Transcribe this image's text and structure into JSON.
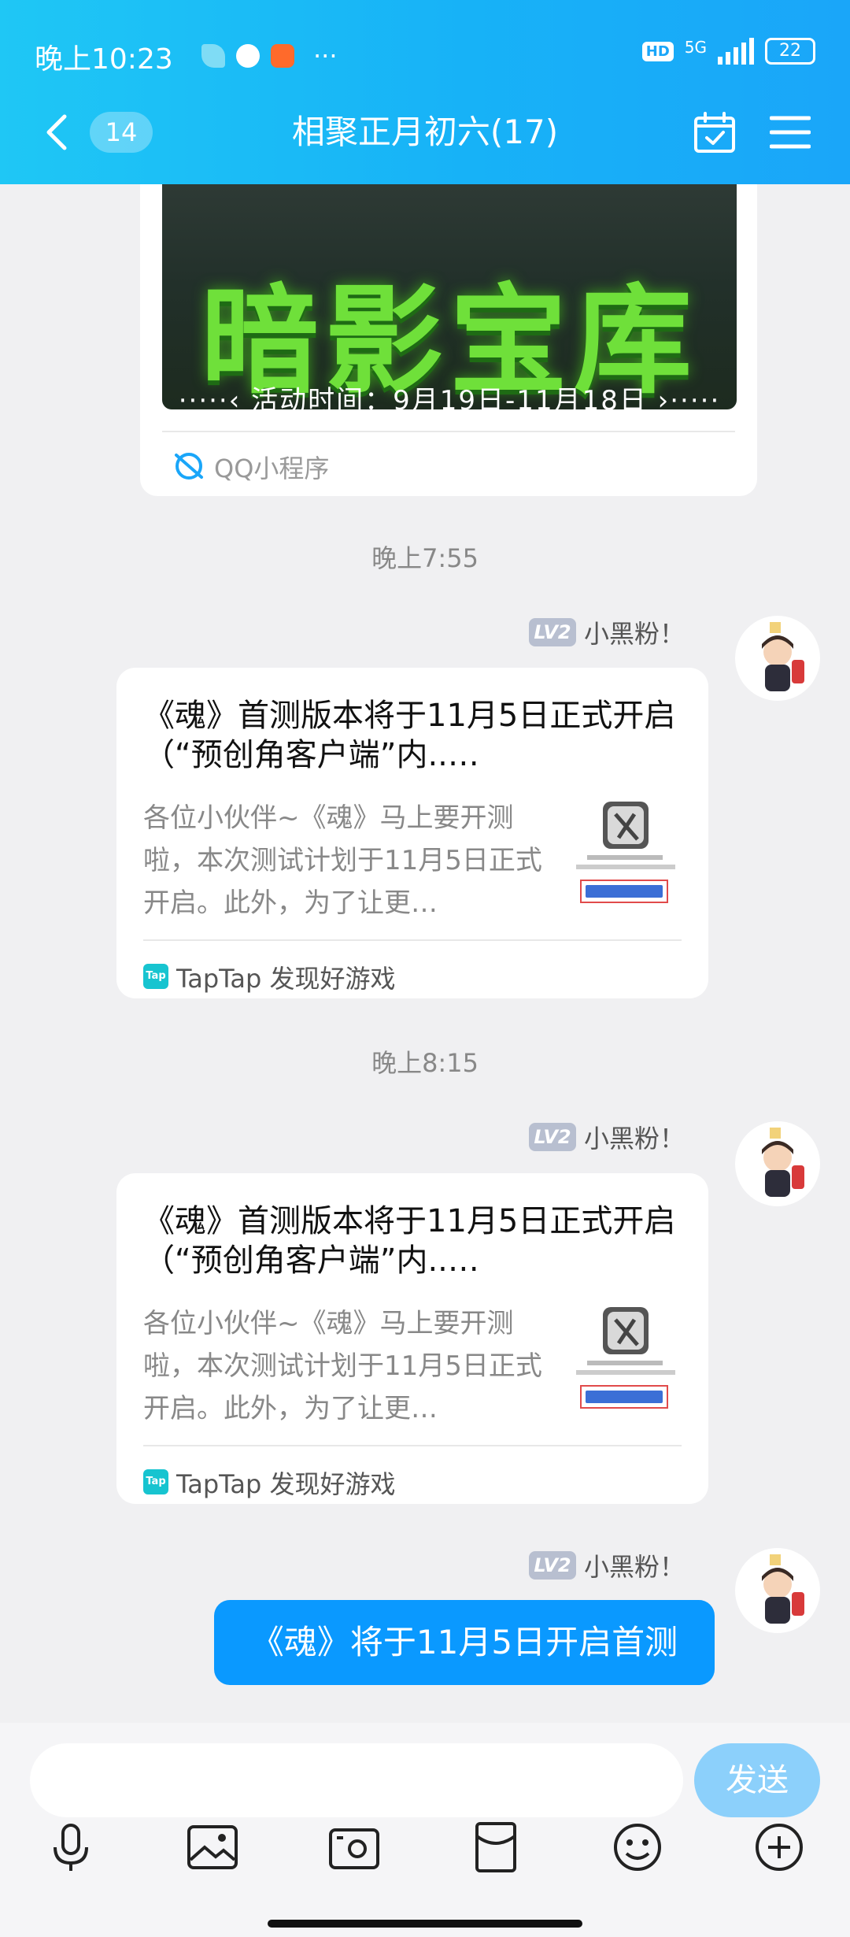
{
  "status_bar": {
    "time": "晚上10:23",
    "more": "···",
    "hd": "HD",
    "network": "5G",
    "battery": "22"
  },
  "header": {
    "unread_count": "14",
    "title": "相聚正月初六(17)"
  },
  "top_card": {
    "banner_title": "暗影宝库",
    "banner_subtitle": "·····‹ 活动时间：9月19日-11月18日 ›·····",
    "source": "QQ小程序"
  },
  "messages": [
    {
      "timestamp": "晚上7:55",
      "level": "LV2",
      "sender": "小黑粉！",
      "title": "《魂》首测版本将于11月5日正式开启（“预创角客户端”内..…",
      "desc": "各位小伙伴~《魂》马上要开测啦，本次测试计划于11月5日正式开启。此外，为了让更…",
      "source_icon": "Tap",
      "source": "TapTap 发现好游戏"
    },
    {
      "timestamp": "晚上8:15",
      "level": "LV2",
      "sender": "小黑粉！",
      "title": "《魂》首测版本将于11月5日正式开启（“预创角客户端”内..…",
      "desc": "各位小伙伴~《魂》马上要开测啦，本次测试计划于11月5日正式开启。此外，为了让更…",
      "source_icon": "Tap",
      "source": "TapTap 发现好游戏"
    },
    {
      "level": "LV2",
      "sender": "小黑粉！",
      "text": "《魂》将于11月5日开启首测"
    }
  ],
  "input": {
    "send_label": "发送"
  },
  "toolbar_icons": [
    "microphone-icon",
    "photo-icon",
    "camera-icon",
    "red-packet-icon",
    "emoji-icon",
    "plus-icon"
  ],
  "colors": {
    "header": "#17b2f7",
    "bubble": "#0a99ff",
    "send": "#8cd0fb",
    "background": "#f0f0f2"
  }
}
